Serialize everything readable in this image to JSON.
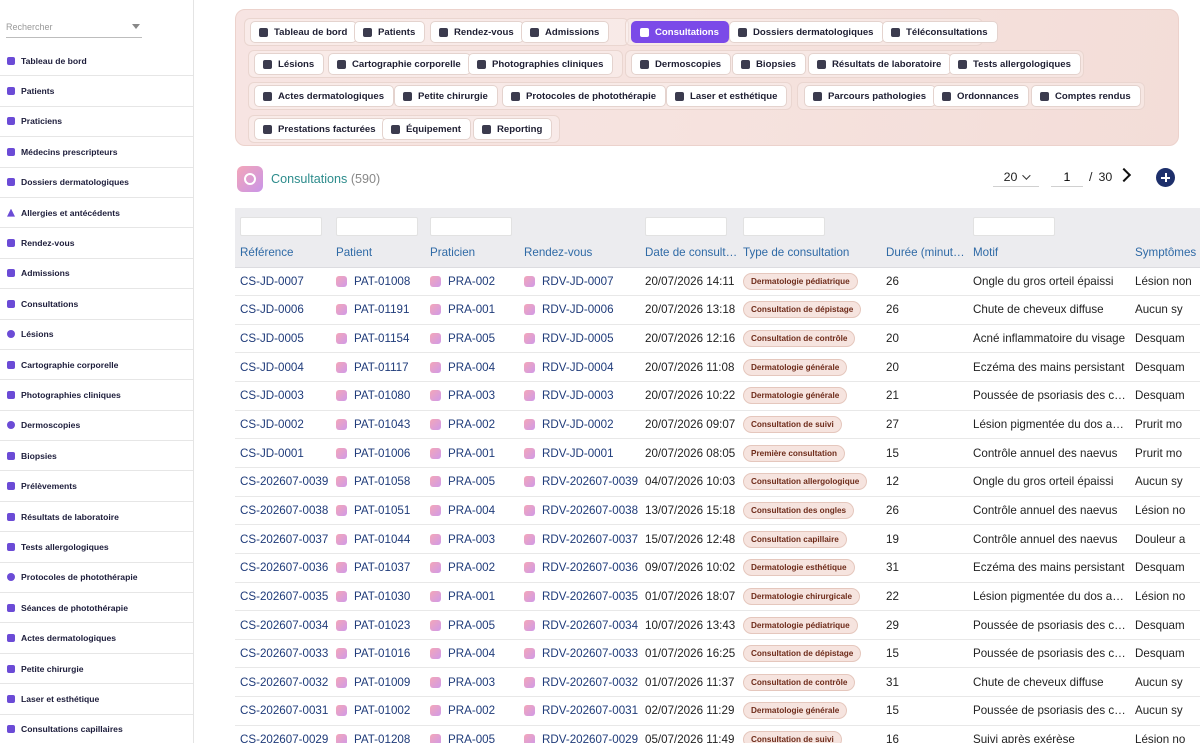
{
  "sidebar": {
    "search_placeholder": "Rechercher",
    "items": [
      {
        "label": "Tableau de bord",
        "icon": "dashboard-icon"
      },
      {
        "label": "Patients",
        "icon": "user-icon"
      },
      {
        "label": "Praticiens",
        "icon": "user-icon"
      },
      {
        "label": "Médecins prescripteurs",
        "icon": "stethoscope-icon"
      },
      {
        "label": "Dossiers dermatologiques",
        "icon": "folder-icon"
      },
      {
        "label": "Allergies et antécédents",
        "icon": "warning-icon"
      },
      {
        "label": "Rendez-vous",
        "icon": "calendar-icon"
      },
      {
        "label": "Admissions",
        "icon": "clipboard-icon"
      },
      {
        "label": "Consultations",
        "icon": "clipboard-icon"
      },
      {
        "label": "Lésions",
        "icon": "circle-icon"
      },
      {
        "label": "Cartographie corporelle",
        "icon": "body-map-icon"
      },
      {
        "label": "Photographies cliniques",
        "icon": "camera-icon"
      },
      {
        "label": "Dermoscopies",
        "icon": "magnifier-icon"
      },
      {
        "label": "Biopsies",
        "icon": "scissors-icon"
      },
      {
        "label": "Prélèvements",
        "icon": "syringe-icon"
      },
      {
        "label": "Résultats de laboratoire",
        "icon": "lab-report-icon"
      },
      {
        "label": "Tests allergologiques",
        "icon": "test-tubes-icon"
      },
      {
        "label": "Protocoles de photothérapie",
        "icon": "sun-icon"
      },
      {
        "label": "Séances de photothérapie",
        "icon": "lightbulb-icon"
      },
      {
        "label": "Actes dermatologiques",
        "icon": "procedure-icon"
      },
      {
        "label": "Petite chirurgie",
        "icon": "bed-icon"
      },
      {
        "label": "Laser et esthétique",
        "icon": "bolt-icon"
      },
      {
        "label": "Consultations capillaires",
        "icon": "hair-icon"
      }
    ]
  },
  "menu": {
    "buttons": [
      {
        "label": "Tableau de bord",
        "icon": "dashboard-icon"
      },
      {
        "label": "Patients",
        "icon": "user-icon"
      },
      {
        "label": "Rendez-vous",
        "icon": "calendar-icon"
      },
      {
        "label": "Admissions",
        "icon": "clipboard-icon"
      },
      {
        "label": "Consultations",
        "icon": "clipboard-icon",
        "active": true
      },
      {
        "label": "Dossiers dermatologiques",
        "icon": "folder-icon"
      },
      {
        "label": "Téléconsultations",
        "icon": "video-icon"
      },
      {
        "label": "Lésions",
        "icon": "circle-icon"
      },
      {
        "label": "Cartographie corporelle",
        "icon": "body-map-icon"
      },
      {
        "label": "Photographies cliniques",
        "icon": "camera-icon"
      },
      {
        "label": "Dermoscopies",
        "icon": "magnifier-icon"
      },
      {
        "label": "Biopsies",
        "icon": "scissors-icon"
      },
      {
        "label": "Résultats de laboratoire",
        "icon": "lab-report-icon"
      },
      {
        "label": "Tests allergologiques",
        "icon": "test-tubes-icon"
      },
      {
        "label": "Actes dermatologiques",
        "icon": "procedure-icon"
      },
      {
        "label": "Petite chirurgie",
        "icon": "bed-icon"
      },
      {
        "label": "Protocoles de photothérapie",
        "icon": "sun-icon"
      },
      {
        "label": "Laser et esthétique",
        "icon": "bolt-icon"
      },
      {
        "label": "Parcours pathologies",
        "icon": "route-icon"
      },
      {
        "label": "Ordonnances",
        "icon": "prescription-icon"
      },
      {
        "label": "Comptes rendus",
        "icon": "report-icon"
      },
      {
        "label": "Prestations facturées",
        "icon": "invoice-icon"
      },
      {
        "label": "Équipement",
        "icon": "equipment-icon"
      },
      {
        "label": "Reporting",
        "icon": "chart-icon"
      }
    ]
  },
  "header": {
    "title": "Consultations",
    "count": "(590)",
    "page_size": "20",
    "page": "1",
    "page_sep": "/",
    "total_pages": "30"
  },
  "table": {
    "columns": [
      "Référence",
      "Patient",
      "Praticien",
      "Rendez-vous",
      "Date de consultation",
      "Type de consultation",
      "Durée (minutes)",
      "Motif",
      "Symptômes"
    ],
    "rows": [
      [
        "CS-JD-0007",
        "PAT-01008",
        "PRA-002",
        "RDV-JD-0007",
        "20/07/2026 14:11",
        "Dermatologie pédiatrique",
        "26",
        "Ongle du gros orteil épaissi",
        "Lésion non"
      ],
      [
        "CS-JD-0006",
        "PAT-01191",
        "PRA-001",
        "RDV-JD-0006",
        "20/07/2026 13:18",
        "Consultation de dépistage",
        "26",
        "Chute de cheveux diffuse",
        "Aucun sy"
      ],
      [
        "CS-JD-0005",
        "PAT-01154",
        "PRA-005",
        "RDV-JD-0005",
        "20/07/2026 12:16",
        "Consultation de contrôle",
        "20",
        "Acné inflammatoire du visage",
        "Desquam"
      ],
      [
        "CS-JD-0004",
        "PAT-01117",
        "PRA-004",
        "RDV-JD-0004",
        "20/07/2026 11:08",
        "Dermatologie générale",
        "20",
        "Eczéma des mains persistant",
        "Desquam"
      ],
      [
        "CS-JD-0003",
        "PAT-01080",
        "PRA-003",
        "RDV-JD-0003",
        "20/07/2026 10:22",
        "Dermatologie générale",
        "21",
        "Poussée de psoriasis des coudes",
        "Desquam"
      ],
      [
        "CS-JD-0002",
        "PAT-01043",
        "PRA-002",
        "RDV-JD-0002",
        "20/07/2026 09:07",
        "Consultation de suivi",
        "27",
        "Lésion pigmentée du dos apparue",
        "Prurit mo"
      ],
      [
        "CS-JD-0001",
        "PAT-01006",
        "PRA-001",
        "RDV-JD-0001",
        "20/07/2026 08:05",
        "Première consultation",
        "15",
        "Contrôle annuel des naevus",
        "Prurit mo"
      ],
      [
        "CS-202607-0039",
        "PAT-01058",
        "PRA-005",
        "RDV-202607-0039",
        "04/07/2026 10:03",
        "Consultation allergologique",
        "12",
        "Ongle du gros orteil épaissi",
        "Aucun sy"
      ],
      [
        "CS-202607-0038",
        "PAT-01051",
        "PRA-004",
        "RDV-202607-0038",
        "13/07/2026 15:18",
        "Consultation des ongles",
        "26",
        "Contrôle annuel des naevus",
        "Lésion no"
      ],
      [
        "CS-202607-0037",
        "PAT-01044",
        "PRA-003",
        "RDV-202607-0037",
        "15/07/2026 12:48",
        "Consultation capillaire",
        "19",
        "Contrôle annuel des naevus",
        "Douleur a"
      ],
      [
        "CS-202607-0036",
        "PAT-01037",
        "PRA-002",
        "RDV-202607-0036",
        "09/07/2026 10:02",
        "Dermatologie esthétique",
        "31",
        "Eczéma des mains persistant",
        "Desquam"
      ],
      [
        "CS-202607-0035",
        "PAT-01030",
        "PRA-001",
        "RDV-202607-0035",
        "01/07/2026 18:07",
        "Dermatologie chirurgicale",
        "22",
        "Lésion pigmentée du dos apparue",
        "Lésion no"
      ],
      [
        "CS-202607-0034",
        "PAT-01023",
        "PRA-005",
        "RDV-202607-0034",
        "10/07/2026 13:43",
        "Dermatologie pédiatrique",
        "29",
        "Poussée de psoriasis des coudes",
        "Desquam"
      ],
      [
        "CS-202607-0033",
        "PAT-01016",
        "PRA-004",
        "RDV-202607-0033",
        "01/07/2026 16:25",
        "Consultation de dépistage",
        "15",
        "Poussée de psoriasis des coudes",
        "Desquam"
      ],
      [
        "CS-202607-0032",
        "PAT-01009",
        "PRA-003",
        "RDV-202607-0032",
        "01/07/2026 11:37",
        "Consultation de contrôle",
        "31",
        "Chute de cheveux diffuse",
        "Aucun sy"
      ],
      [
        "CS-202607-0031",
        "PAT-01002",
        "PRA-002",
        "RDV-202607-0031",
        "02/07/2026 11:29",
        "Dermatologie générale",
        "15",
        "Poussée de psoriasis des coudes",
        "Aucun sy"
      ],
      [
        "CS-202607-0029",
        "PAT-01208",
        "PRA-005",
        "RDV-202607-0029",
        "05/07/2026 11:49",
        "Consultation de suivi",
        "16",
        "Suivi après exérèse",
        "Lésion no"
      ]
    ]
  }
}
